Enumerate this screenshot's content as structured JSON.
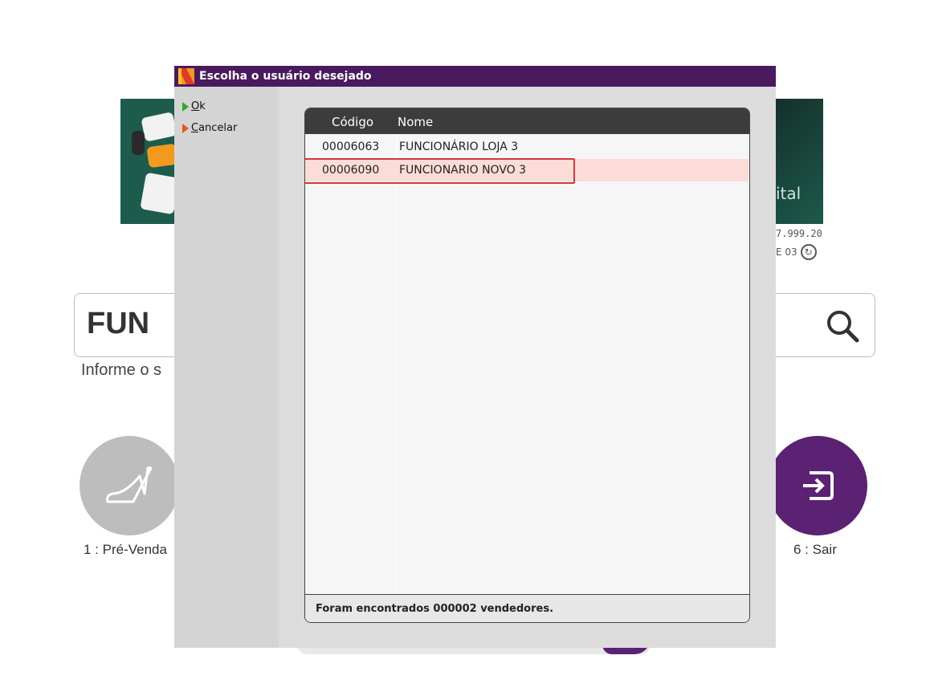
{
  "background": {
    "version_line1": "7.999.20",
    "version_line2": "E  03",
    "banner_text": "ital",
    "search": {
      "value": "FUN"
    },
    "hint": "Informe o s",
    "buttons": [
      {
        "label": "1 : Pré-Venda",
        "icon": "high-heel-shoe-icon"
      },
      {
        "label": "6 : Sair",
        "icon": "exit-icon"
      }
    ],
    "colors": {
      "accent": "#5b2173",
      "banner": "#1d5c4c"
    }
  },
  "dialog": {
    "title": "Escolha o usuário desejado",
    "menu": {
      "ok_key": "O",
      "ok_rest": "k",
      "cancel_key": "C",
      "cancel_rest": "ancelar"
    },
    "table": {
      "columns": [
        "Código",
        "Nome"
      ],
      "rows": [
        {
          "code": "00006063",
          "name": "FUNCIONÁRIO LOJA 3"
        },
        {
          "code": "00006090",
          "name": "FUNCIONARIO NOVO 3"
        }
      ],
      "footer": "Foram encontrados 000002 vendedores."
    },
    "colors": {
      "titlebar": "#4a1a5e",
      "selected_row": "#fbdcd6",
      "highlight": "#d23a3a"
    }
  }
}
